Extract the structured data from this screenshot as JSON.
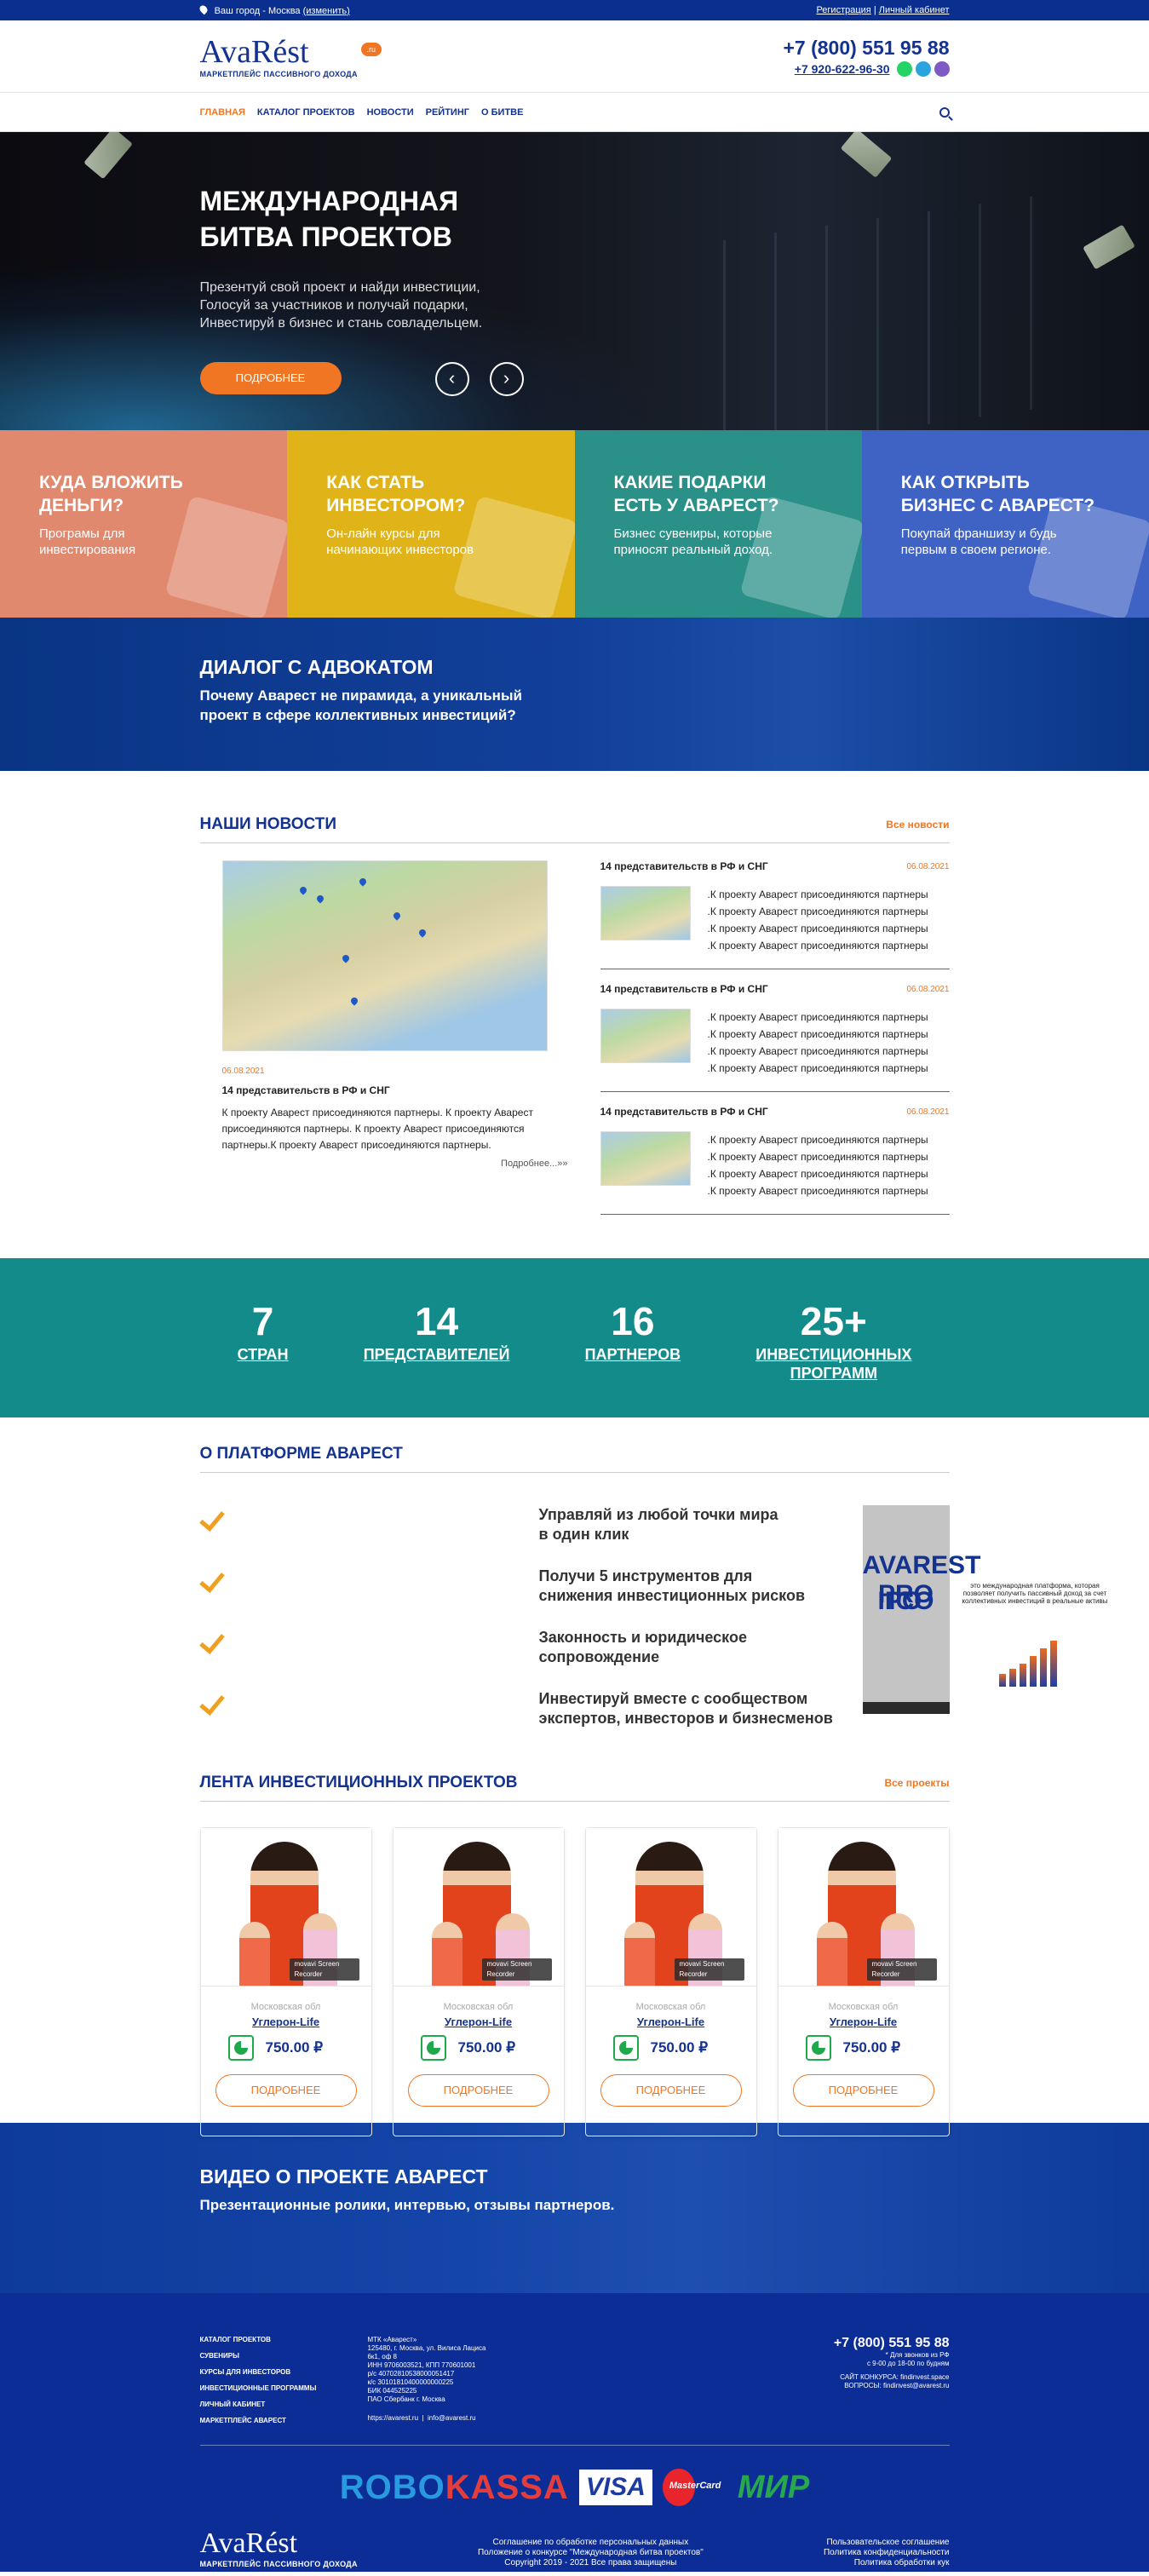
{
  "topbar": {
    "city_prefix": "Ваш город - Москва",
    "city_change": "(изменить)",
    "register": "Регистрация",
    "separator": "|",
    "cabinet": "Личный кабинет"
  },
  "header": {
    "logo_text": "AvaRést",
    "logo_badge": ".ru",
    "logo_tagline": "МАРКЕТПЛЕЙС ПАССИВНОГО ДОХОДА",
    "phone_main": "+7 (800) 551 95 88",
    "phone_second": "+7 920-622-96-30",
    "messengers": [
      {
        "name": "whatsapp",
        "color": "#25d366"
      },
      {
        "name": "telegram",
        "color": "#2aa3df"
      },
      {
        "name": "viber",
        "color": "#7d5ac4"
      }
    ]
  },
  "nav": {
    "items": [
      "ГЛАВНАЯ",
      "КАТАЛОГ ПРОЕКТОВ",
      "НОВОСТИ",
      "РЕЙТИНГ",
      "О БИТВЕ"
    ],
    "active_index": 0
  },
  "hero": {
    "title_line1": "МЕЖДУНАРОДНАЯ",
    "title_line2": "БИТВА ПРОЕКТОВ",
    "text_line1": "Презентуй свой проект и найди инвестиции,",
    "text_line2": "Голосуй за участников и получай подарки,",
    "text_line3": "Инвестируй в бизнес и стань совладельцем.",
    "button": "ПОДРОБНЕЕ",
    "prev": "‹",
    "next": "›"
  },
  "tiles": [
    {
      "title_1": "КУДА ВЛОЖИТЬ",
      "title_2": "ДЕНЬГИ?",
      "text_1": "Програмы для",
      "text_2": "инвестирования"
    },
    {
      "title_1": "КАК СТАТЬ",
      "title_2": "ИНВЕСТОРОМ?",
      "text_1": "Он-лайн курсы для",
      "text_2": "начинающих инвесторов"
    },
    {
      "title_1": "КАКИЕ ПОДАРКИ",
      "title_2": "ЕСТЬ У АВАРЕСТ?",
      "text_1": "Бизнес сувениры, которые",
      "text_2": "приносят реальный доход."
    },
    {
      "title_1": "КАК ОТКРЫТЬ",
      "title_2": "БИЗНЕС С АВАРЕСТ?",
      "text_1": "Покупай франшизу и будь",
      "text_2": "первым в своем регионе."
    }
  ],
  "lawyer": {
    "title": "ДИАЛОГ С АДВОКАТОМ",
    "text_1": "Почему Аварест не пирамида, а уникальный",
    "text_2": "проект в сфере коллективных инвестиций?"
  },
  "news": {
    "title": "НАШИ НОВОСТИ",
    "all_link": "Все новости",
    "featured": {
      "date": "06.08.2021",
      "title": "14 представительств в РФ и СНГ",
      "text": "К проекту Аварест присоединяются партнеры. К проекту Аварест присоединяются партнеры. К проекту Аварест присоединяются партнеры.К проекту Аварест присоединяются партнеры.",
      "more": "Подробнее...»»"
    },
    "items": [
      {
        "title": "14 представительств в РФ и СНГ",
        "date": "06.08.2021",
        "lines": [
          ".К проекту Аварест присоединяются партнеры",
          ".К проекту Аварест присоединяются партнеры",
          ".К проекту Аварест присоединяются партнеры",
          ".К проекту Аварест присоединяются партнеры"
        ]
      },
      {
        "title": "14 представительств в РФ и СНГ",
        "date": "06.08.2021",
        "lines": ".К проекту Аварест присоединяются партнеры|.К проекту Аварест присоединяются партнеры|.К проекту Аварест присоединяются партнеры|.К проекту Аварест присоединяются партнеры"
      },
      {
        "title": "14 представительств в РФ и СНГ",
        "date": "06.08.2021",
        "lines": ".К проекту Аварест присоединяются партнеры|.К проекту Аварест присоединяются партнеры|.К проекту Аварест присоединяются партнеры|.К проекту Аварест присоединяются партнеры"
      }
    ]
  },
  "stats": [
    {
      "num": "7",
      "label_1": "СТРАН",
      "label_2": ""
    },
    {
      "num": "14",
      "label_1": "ПРЕДСТАВИТЕЛЕЙ",
      "label_2": ""
    },
    {
      "num": "16",
      "label_1": "ПАРТНЕРОВ",
      "label_2": ""
    },
    {
      "num": "25+",
      "label_1": "ИНВЕСТИЦИОННЫХ",
      "label_2": "ПРОГРАММ"
    }
  ],
  "platform": {
    "title": "О ПЛАТФОРМЕ АВАРЕСТ",
    "features": [
      {
        "line1": "Управляй из любой точки мира",
        "line2": "в один клик"
      },
      {
        "line1": "Получи 5 инструментов для",
        "line2": "снижения инвестиционных рисков"
      },
      {
        "line1": "Законность и юридическое",
        "line2": "сопровождение"
      },
      {
        "line1": "Инвестируй вместе с сообществом",
        "line2": "экспертов, инвесторов и бизнесменов"
      }
    ],
    "video": {
      "title": "AVAREST PRO",
      "left": "IPO",
      "right": "ICO",
      "desc": "это международная платформа, которая позволяет получить пассивный доход за счет коллективных инвестиций в реальные активы",
      "bar_levels": [
        0.25,
        0.35,
        0.45,
        0.6,
        0.75,
        0.9
      ]
    }
  },
  "projects": {
    "title": "ЛЕНТА ИНВЕСТИЦИОННЫХ ПРОЕКТОВ",
    "all_link": "Все проекты",
    "cards": [
      {
        "region": "Московская обл",
        "name": "Углерон-Life",
        "price": "750.00 ₽",
        "button": "ПОДРОБНЕЕ",
        "rec": "movavi Screen Recorder"
      },
      {
        "region": "Московская обл",
        "name": "Углерон-Life",
        "price": "750.00 ₽",
        "button": "ПОДРОБНЕЕ",
        "rec": "movavi Screen Recorder"
      },
      {
        "region": "Московская обл",
        "name": "Углерон-Life",
        "price": "750.00 ₽",
        "button": "ПОДРОБНЕЕ",
        "rec": "movavi Screen Recorder"
      },
      {
        "region": "Московская обл",
        "name": "Углерон-Life",
        "price": "750.00 ₽",
        "button": "ПОДРОБНЕЕ",
        "rec": "movavi Screen Recorder"
      }
    ]
  },
  "video_banner": {
    "title": "ВИДЕО О ПРОЕКТЕ АВАРЕСТ",
    "text": "Презентационные ролики, интервью, отзывы партнеров."
  },
  "footer": {
    "links": [
      "КАТАЛОГ ПРОЕКТОВ",
      "СУВЕНИРЫ",
      "КУРСЫ ДЛЯ ИНВЕСТОРОВ",
      "ИНВЕСТИЦИОННЫЕ ПРОГРАММЫ",
      "ЛИЧНЫЙ КАБИНЕТ",
      "МАРКЕТПЛЕЙС АВАРЕСТ"
    ],
    "company": [
      "МТК «Аварест»",
      "125480, г. Москва, ул. Вилиса Лациса",
      "6к1, оф 8",
      "ИНН 9706003521, КПП 770601001",
      "р/с 40702810538000051417",
      "к/с 30101810400000000225",
      "БИК 044525225",
      "ПАО Сбербанк г. Москва"
    ],
    "site": "https://avarest.ru",
    "sep": "|",
    "email": "info@avarest.ru",
    "phone": "+7 (800) 551 95 88",
    "phone_note_1": "* Для звонков из РФ",
    "phone_note_2": "с 9-00 до 18-00 по будням",
    "contest_1": "САЙТ КОНКУРСА: findinvest.space",
    "contest_2": "ВОПРОСЫ: findinvest@avarest.ru",
    "pay_robo_1": "ROBO",
    "pay_robo_2": "KASSA",
    "pay_visa": "VISA",
    "pay_mc": "MasterCard",
    "pay_mir": "МИР",
    "mid_1": "Соглашение по обработке персональных данных",
    "mid_2": "Положение о конкурсе \"Международная битва проектов\"",
    "mid_3": "Copyright 2019 - 2021  Все права защищены",
    "right_1": "Пользовательское соглашение",
    "right_2": "Политика конфиденциальности",
    "right_3": "Политика обработки кук"
  }
}
